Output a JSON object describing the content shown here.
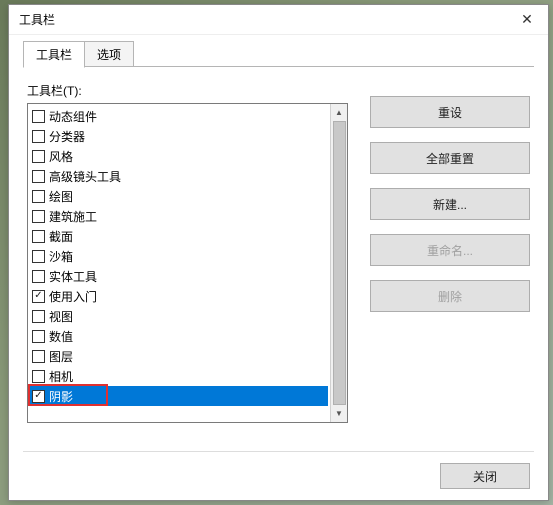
{
  "window": {
    "title": "工具栏",
    "close_symbol": "✕"
  },
  "tabs": {
    "items": [
      {
        "label": "工具栏",
        "active": true
      },
      {
        "label": "选项",
        "active": false
      }
    ]
  },
  "listbox": {
    "label": "工具栏(T):",
    "items": [
      {
        "label": "动态组件",
        "checked": false,
        "selected": false
      },
      {
        "label": "分类器",
        "checked": false,
        "selected": false
      },
      {
        "label": "风格",
        "checked": false,
        "selected": false
      },
      {
        "label": "高级镜头工具",
        "checked": false,
        "selected": false
      },
      {
        "label": "绘图",
        "checked": false,
        "selected": false
      },
      {
        "label": "建筑施工",
        "checked": false,
        "selected": false
      },
      {
        "label": "截面",
        "checked": false,
        "selected": false
      },
      {
        "label": "沙箱",
        "checked": false,
        "selected": false
      },
      {
        "label": "实体工具",
        "checked": false,
        "selected": false
      },
      {
        "label": "使用入门",
        "checked": true,
        "selected": false
      },
      {
        "label": "视图",
        "checked": false,
        "selected": false
      },
      {
        "label": "数值",
        "checked": false,
        "selected": false
      },
      {
        "label": "图层",
        "checked": false,
        "selected": false
      },
      {
        "label": "相机",
        "checked": false,
        "selected": false
      },
      {
        "label": "阴影",
        "checked": true,
        "selected": true,
        "highlighted": true
      }
    ]
  },
  "buttons": {
    "reset": {
      "label": "重设",
      "enabled": true
    },
    "reset_all": {
      "label": "全部重置",
      "enabled": true
    },
    "new": {
      "label": "新建...",
      "enabled": true
    },
    "rename": {
      "label": "重命名...",
      "enabled": false
    },
    "delete": {
      "label": "删除",
      "enabled": false
    }
  },
  "footer": {
    "close_label": "关闭"
  }
}
